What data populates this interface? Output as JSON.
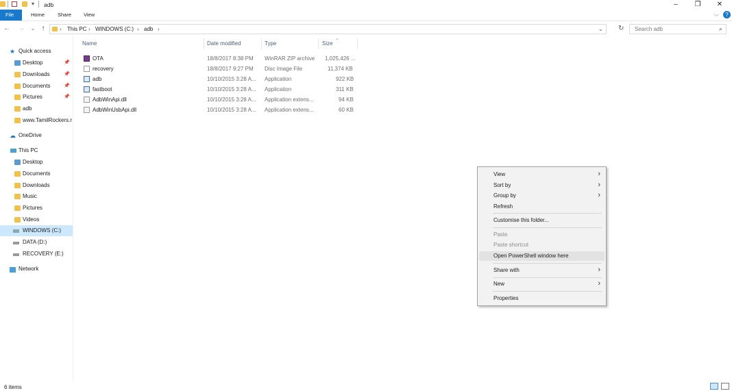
{
  "window": {
    "title": "adb",
    "controls": [
      "minimize-icon",
      "restore-icon",
      "close-icon"
    ]
  },
  "ribbon": {
    "tabs": [
      "File",
      "Home",
      "Share",
      "View"
    ]
  },
  "address": {
    "crumbs": [
      "This PC",
      "WINDOWS (C:)",
      "adb"
    ],
    "search_placeholder": "Search adb"
  },
  "sidebar": {
    "quick_access": "Quick access",
    "quick_items": [
      "Desktop",
      "Downloads",
      "Documents",
      "Pictures",
      "adb",
      "www.TamilRockers.r"
    ],
    "onedrive": "OneDrive",
    "this_pc": "This PC",
    "pc_items": [
      "Desktop",
      "Documents",
      "Downloads",
      "Music",
      "Pictures",
      "Videos",
      "WINDOWS (C:)",
      "DATA (D:)",
      "RECOVERY (E:)"
    ],
    "network": "Network"
  },
  "filelist": {
    "columns": [
      "Name",
      "Date modified",
      "Type",
      "Size"
    ],
    "rows": [
      {
        "name": "OTA",
        "date": "18/8/2017 8:38 PM",
        "type": "WinRAR ZIP archive",
        "size": "1,025,426 ..."
      },
      {
        "name": "recovery",
        "date": "18/8/2017 9:27 PM",
        "type": "Disc Image File",
        "size": "11,374 KB"
      },
      {
        "name": "adb",
        "date": "10/10/2015 3:28 A...",
        "type": "Application",
        "size": "922 KB"
      },
      {
        "name": "fastboot",
        "date": "10/10/2015 3:28 A...",
        "type": "Application",
        "size": "311 KB"
      },
      {
        "name": "AdbWinApi.dll",
        "date": "10/10/2015 3:28 A...",
        "type": "Application extens...",
        "size": "94 KB"
      },
      {
        "name": "AdbWinUsbApi.dll",
        "date": "10/10/2015 3:28 A...",
        "type": "Application extens...",
        "size": "60 KB"
      }
    ]
  },
  "context_menu": {
    "view": "View",
    "sort_by": "Sort by",
    "group_by": "Group by",
    "refresh": "Refresh",
    "customise": "Customise this folder...",
    "paste": "Paste",
    "paste_shortcut": "Paste shortcut",
    "open_powershell": "Open PowerShell window here",
    "share_with": "Share with",
    "new": "New",
    "properties": "Properties"
  },
  "status": {
    "item_count": "6 items"
  },
  "colors": {
    "accent": "#1979ca",
    "selection": "#cce8ff",
    "folder": "#f0c24a"
  }
}
